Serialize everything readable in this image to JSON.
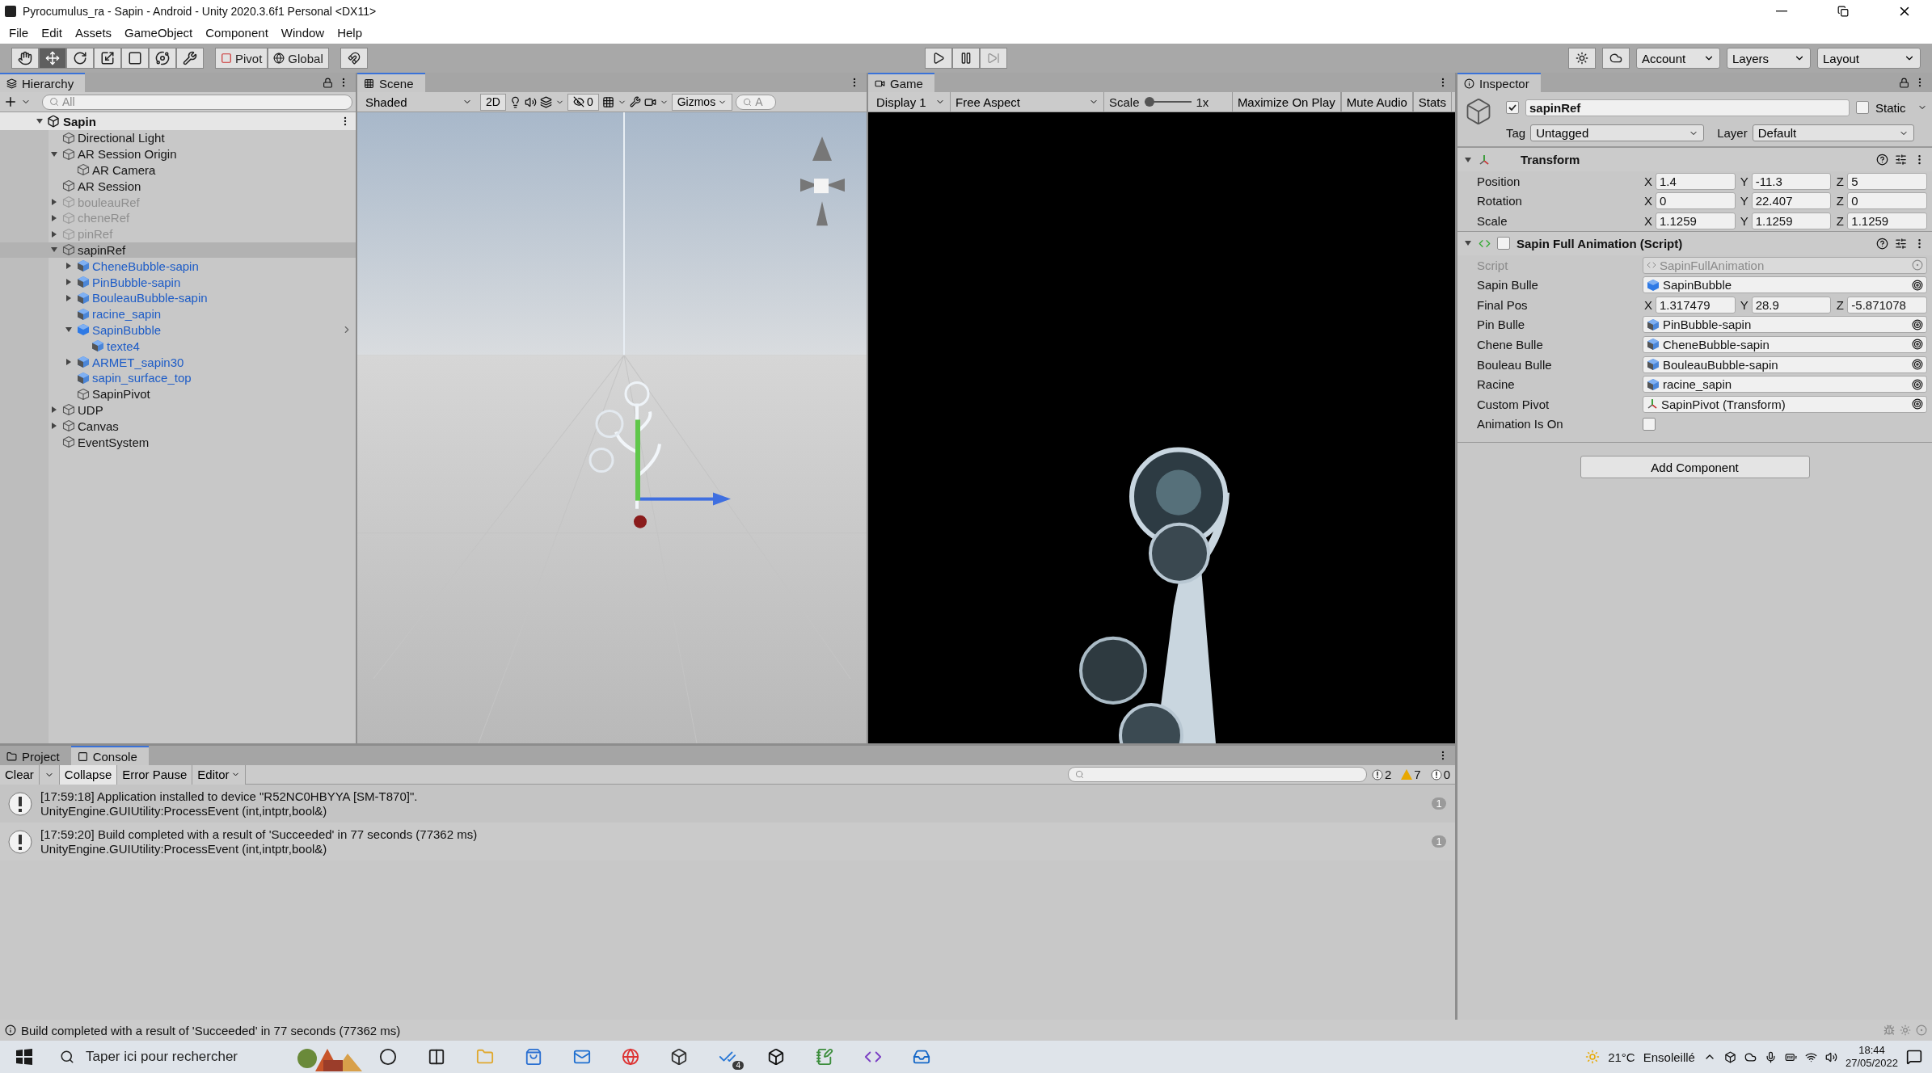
{
  "window": {
    "title": "Pyrocumulus_ra - Sapin - Android - Unity 2020.3.6f1 Personal <DX11>"
  },
  "menu": [
    "File",
    "Edit",
    "Assets",
    "GameObject",
    "Component",
    "Window",
    "Help"
  ],
  "toolbar": {
    "tools": [
      {
        "kind": "hand",
        "selected": false
      },
      {
        "kind": "move",
        "selected": true
      },
      {
        "kind": "rotate",
        "selected": false
      },
      {
        "kind": "scale",
        "selected": false
      },
      {
        "kind": "rect",
        "selected": false
      },
      {
        "kind": "transform",
        "selected": false
      },
      {
        "kind": "custom",
        "selected": false
      }
    ],
    "pivot": "Pivot",
    "global": "Global",
    "account": "Account",
    "layers": "Layers",
    "layout": "Layout"
  },
  "hierarchy": {
    "title": "Hierarchy",
    "search_placeholder": "All",
    "scene": {
      "name": "Sapin",
      "expanded": true
    },
    "items": [
      {
        "name": "Directional Light",
        "kind": "object",
        "disabled": false,
        "selected": false
      },
      {
        "name": "AR Session Origin",
        "kind": "object",
        "disabled": false,
        "selected": false,
        "expanded": true,
        "children": [
          {
            "name": "AR Camera",
            "kind": "object",
            "disabled": false,
            "selected": false
          }
        ]
      },
      {
        "name": "AR Session",
        "kind": "object",
        "disabled": false,
        "selected": false
      },
      {
        "name": "bouleauRef",
        "kind": "object",
        "disabled": true,
        "selected": false,
        "expanded": false
      },
      {
        "name": "cheneRef",
        "kind": "object",
        "disabled": true,
        "selected": false,
        "expanded": false
      },
      {
        "name": "pinRef",
        "kind": "object",
        "disabled": true,
        "selected": false,
        "expanded": false
      },
      {
        "name": "sapinRef",
        "kind": "object",
        "disabled": false,
        "selected": true,
        "expanded": true,
        "children": [
          {
            "name": "CheneBubble-sapin",
            "kind": "prefab",
            "disabled": false,
            "selected": false,
            "expanded": false
          },
          {
            "name": "PinBubble-sapin",
            "kind": "prefab",
            "disabled": false,
            "selected": false,
            "expanded": false
          },
          {
            "name": "BouleauBubble-sapin",
            "kind": "prefab",
            "disabled": false,
            "selected": false,
            "expanded": false
          },
          {
            "name": "racine_sapin",
            "kind": "prefab",
            "disabled": false,
            "selected": false
          },
          {
            "name": "SapinBubble",
            "kind": "prefab_root",
            "disabled": false,
            "selected": false,
            "expanded": true,
            "override_arrow": true,
            "children": [
              {
                "name": "texte4",
                "kind": "prefab",
                "disabled": false,
                "selected": false
              }
            ]
          },
          {
            "name": "ARMET_sapin30",
            "kind": "prefab",
            "disabled": false,
            "selected": false,
            "expanded": false
          },
          {
            "name": "sapin_surface_top",
            "kind": "prefab",
            "disabled": false,
            "selected": false
          },
          {
            "name": "SapinPivot",
            "kind": "object",
            "disabled": false,
            "selected": false
          }
        ]
      },
      {
        "name": "UDP",
        "kind": "object",
        "disabled": false,
        "selected": false,
        "expanded": false
      },
      {
        "name": "Canvas",
        "kind": "object",
        "disabled": false,
        "selected": false,
        "expanded": false
      },
      {
        "name": "EventSystem",
        "kind": "object",
        "disabled": false,
        "selected": false
      }
    ]
  },
  "scene": {
    "title": "Scene",
    "shading": "Shaded",
    "mode_2d": "2D",
    "hidden_count": "0",
    "gizmos": "Gizmos",
    "search_placeholder": "A"
  },
  "game": {
    "title": "Game",
    "display": "Display 1",
    "aspect": "Free Aspect",
    "scale_label": "Scale",
    "scale": {
      "level": 0
    },
    "scale_value": "1x",
    "buttons": [
      "Maximize On Play",
      "Mute Audio",
      "Stats"
    ]
  },
  "inspector": {
    "title": "Inspector",
    "object": {
      "active": true,
      "name": "sapinRef",
      "static": false,
      "static_label": "Static",
      "tag_label": "Tag",
      "tag": "Untagged",
      "layer_label": "Layer",
      "layer": "Default"
    },
    "transform": {
      "title": "Transform",
      "expanded": true,
      "rows": [
        {
          "label": "Position",
          "values": [
            {
              "axis": "X",
              "value": "1.4"
            },
            {
              "axis": "Y",
              "value": "-11.3"
            },
            {
              "axis": "Z",
              "value": "5"
            }
          ]
        },
        {
          "label": "Rotation",
          "values": [
            {
              "axis": "X",
              "value": "0"
            },
            {
              "axis": "Y",
              "value": "22.407"
            },
            {
              "axis": "Z",
              "value": "0"
            }
          ]
        },
        {
          "label": "Scale",
          "values": [
            {
              "axis": "X",
              "value": "1.1259"
            },
            {
              "axis": "Y",
              "value": "1.1259"
            },
            {
              "axis": "Z",
              "value": "1.1259"
            }
          ]
        }
      ]
    },
    "script": {
      "title": "Sapin Full Animation (Script)",
      "enabled": false,
      "expanded": true,
      "fields": [
        {
          "kind": "script",
          "label": "Script",
          "value": "SapinFullAnimation"
        },
        {
          "kind": "object",
          "label": "Sapin Bulle",
          "target": {
            "kind": "prefab_root",
            "value": "SapinBubble"
          }
        },
        {
          "kind": "vector",
          "label": "Final Pos",
          "values": [
            {
              "axis": "X",
              "value": "1.317479"
            },
            {
              "axis": "Y",
              "value": "28.9"
            },
            {
              "axis": "Z",
              "value": "-5.871078"
            }
          ]
        },
        {
          "kind": "object",
          "label": "Pin Bulle",
          "target": {
            "kind": "prefab",
            "value": "PinBubble-sapin"
          }
        },
        {
          "kind": "object",
          "label": "Chene Bulle",
          "target": {
            "kind": "prefab",
            "value": "CheneBubble-sapin"
          }
        },
        {
          "kind": "object",
          "label": "Bouleau Bulle",
          "target": {
            "kind": "prefab",
            "value": "BouleauBubble-sapin"
          }
        },
        {
          "kind": "object",
          "label": "Racine",
          "target": {
            "kind": "prefab",
            "value": "racine_sapin"
          }
        },
        {
          "kind": "object",
          "label": "Custom Pivot",
          "target": {
            "kind": "transform",
            "value": "SapinPivot (Transform)"
          }
        },
        {
          "kind": "toggle",
          "label": "Animation Is On",
          "checked": false
        }
      ]
    },
    "add_component": "Add Component"
  },
  "console": {
    "tabs": [
      {
        "label": "Project",
        "selected": false
      },
      {
        "label": "Console",
        "selected": true
      }
    ],
    "clear": "Clear",
    "collapse": {
      "label": "Collapse",
      "on": true
    },
    "error_pause": {
      "label": "Error Pause",
      "on": false
    },
    "editor": "Editor",
    "counts": [
      {
        "kind": "info",
        "count": "2"
      },
      {
        "kind": "warning",
        "count": "7"
      },
      {
        "kind": "error",
        "count": "0"
      }
    ],
    "messages": [
      {
        "text": "[17:59:18] Application installed to device \"R52NC0HBYYA [SM-T870]\".",
        "detail": "UnityEngine.GUIUtility:ProcessEvent (int,intptr,bool&)",
        "count": "1"
      },
      {
        "text": "[17:59:20] Build completed with a result of 'Succeeded' in 77 seconds (77362 ms)",
        "detail": "UnityEngine.GUIUtility:ProcessEvent (int,intptr,bool&)",
        "count": "1"
      }
    ]
  },
  "status_bar": {
    "message": "Build completed with a result of 'Succeeded' in 77 seconds (77362 ms)"
  },
  "taskbar": {
    "search_placeholder": "Taper ici pour rechercher",
    "apps": [
      {
        "kind": "cortana"
      },
      {
        "kind": "task_view"
      },
      {
        "kind": "folder"
      },
      {
        "kind": "store"
      },
      {
        "kind": "mail"
      },
      {
        "kind": "browser"
      },
      {
        "kind": "unity_hub"
      },
      {
        "kind": "tasks",
        "badge": "4"
      },
      {
        "kind": "unity"
      },
      {
        "kind": "notepad"
      },
      {
        "kind": "visual_studio"
      },
      {
        "kind": "outlook"
      }
    ],
    "temperature": "21°C",
    "weather": "Ensoleillé",
    "time": "18:44",
    "date": "27/05/2022"
  }
}
